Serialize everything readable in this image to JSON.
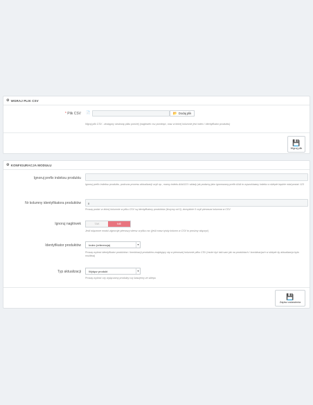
{
  "upload": {
    "title": "WGRAJ PLIK CSV",
    "file_label": "Plik CSV",
    "required_mark": "*",
    "add_file_button": "Dodaj plik",
    "help": "Wgraj plik CSV - dostępny strukturę pliku poniżej (nagłówek csv pominięć, oraz w której kolumnie jest index / identyfikator produktu)",
    "upload_button": "Wgraj plik"
  },
  "config": {
    "title": "KONFIGURACJA MODUŁU",
    "prefix_label": "Ignoruj prefix indeksu produktu",
    "prefix_value": "",
    "prefix_help": "Ignoruj prefix indeksu produktu, podczas procesu aktualizacji czyli np., mamy indeks AAA123 i sklady jak podamy jako ignorowany prefix AAA to wyszukiwany indeks w sklepie będzie miał postać 123",
    "column_label": "Nr kolumny identyfikatora produktów",
    "column_value": "0",
    "column_help": "Proszę podać w której kolumnie w pliku CSV są identyfikatory produktów (liczymy od 0), domyślnie 0 czyli pierwsza kolumna w CSV",
    "ignore_header_label": "Ignoruj nagłówek",
    "toggle_yes": "TAK",
    "toggle_no": "NIE",
    "ignore_header_help": "Jeśli włączone moduł zignoruje pierwszy wiersz w pliku csv (jeśli masz tytuły kolumn w CSV to prosimy włączyć)",
    "identifier_label": "Identyfikator produktów",
    "identifier_value": "Index (referencja)",
    "identifier_help": "Proszę wybrać identyfikator produktów / kombinacji produktów znajdujący się w pierwszej kolumnie pliku CSV (może być taki sam jak na produktach / kombinacjach w sklepie by aktualizacja była możliwa)",
    "update_type_label": "Typ aktualizacji",
    "update_type_value": "Wyłącz produkt",
    "update_type_help": "Proszę wybrać czy wyłączamy produkty czy kasujemy ze sklepu",
    "save_button": "Zapisz ustawienia"
  },
  "icons": {
    "cog": "gear-icon",
    "file": "file-icon",
    "save": "floppy-disk-icon",
    "chevron": "chevron-down-icon"
  },
  "colors": {
    "toggle_active": "#e8747f",
    "required": "#e54e4e"
  }
}
